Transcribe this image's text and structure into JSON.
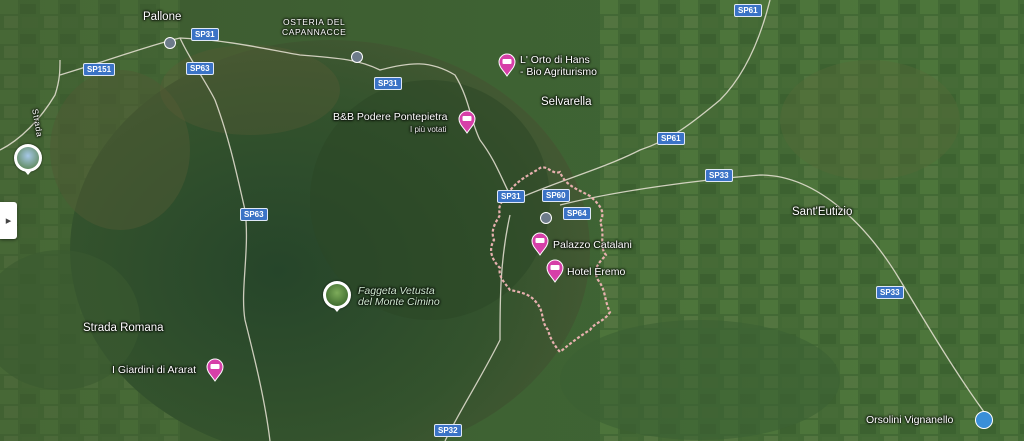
{
  "map": {
    "places": {
      "pallone": "Pallone",
      "osteria": "OSTERIA DEL\nCAPANNACCE",
      "selvarella": "Selvarella",
      "sant_eutizio": "Sant'Eutizio",
      "strada_romana": "Strada Romana",
      "strada_left": "Strada",
      "orsolini": "Orsolini Vignanello"
    },
    "pois": {
      "orto": "L' Orto di Hans\n- Bio Agriturismo",
      "pontepietra": "B&B Podere Pontepietra",
      "pontepietra_sub": "I più votati",
      "catalani": "Palazzo Catalani",
      "eremo": "Hotel Eremo",
      "ararat": "I Giardini di Ararat"
    },
    "park": "Faggeta Vetusta\ndel Monte Cimino",
    "roads": {
      "sp31_a": "SP31",
      "sp31_b": "SP31",
      "sp31_c": "SP31",
      "sp151": "SP151",
      "sp63_a": "SP63",
      "sp63_b": "SP63",
      "sp61_a": "SP61",
      "sp61_b": "SP61",
      "sp60": "SP60",
      "sp64": "SP64",
      "sp33_a": "SP33",
      "sp33_b": "SP33",
      "sp32": "SP32"
    },
    "colors": {
      "poi_pin": "#d63fa8",
      "road_shield": "#3b73c6",
      "boundary": "#f0b5b5",
      "road_line": "#e9e4d6"
    },
    "side_handle_icon": "chevron-right-icon"
  }
}
